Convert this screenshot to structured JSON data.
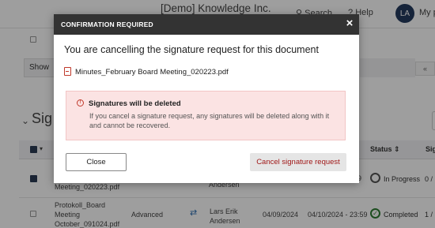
{
  "app": {
    "title": "[Demo] Knowledge Inc.",
    "search_label": "Search",
    "help_label": "Help",
    "avatar_initials": "LA",
    "account_label": "My p"
  },
  "list": {
    "show_label": "Show",
    "pager_right": "«"
  },
  "section": {
    "title": "Sig"
  },
  "table": {
    "columns": {
      "status": "Status",
      "signatures": "Sig"
    },
    "rows": [
      {
        "file": "Meeting_020223.pdf",
        "signer": "Andersen",
        "extra": "9",
        "status": "In Progress",
        "signatures": "0 /"
      },
      {
        "file_lines": [
          "Protokoll_Board",
          "Meeting",
          "October_091024.pdf"
        ],
        "type": "Advanced",
        "signer_lines": [
          "Lars Erik",
          "Andersen"
        ],
        "date_1": "04/09/2024",
        "date_2": "04/10/2024 - 23:59",
        "status": "Completed",
        "signatures": "1 /"
      }
    ]
  },
  "modal": {
    "header": "CONFIRMATION REQUIRED",
    "close_icon": "×",
    "heading": "You are cancelling the signature request for this document",
    "file_icon": "pdf-file-icon",
    "file_name": "Minutes_February Board Meeting_020223.pdf",
    "alert": {
      "icon": "!",
      "title": "Signatures will be deleted",
      "body": "If you cancel a signature request, any signatures will be deleted along with it and cannot be recovered."
    },
    "close_button": "Close",
    "cancel_button": "Cancel signature request"
  },
  "colors": {
    "modal_header": "#333333",
    "alert_background": "#fbe3e3",
    "danger_text": "#a01818",
    "overlay": "rgba(0,0,0,0.38)"
  }
}
